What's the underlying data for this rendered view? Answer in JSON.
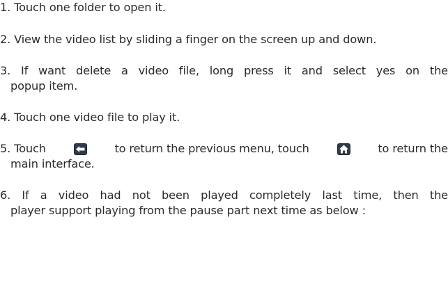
{
  "steps": [
    {
      "lines": [
        "1. Touch one folder to open it."
      ]
    },
    {
      "lines": [
        "2. View the video list by sliding a finger on the screen up and down."
      ]
    },
    {
      "lines": [
        "3. If want delete a video file, long press it and select yes on the",
        "popup item."
      ]
    },
    {
      "lines": [
        "4. Touch one video file to play it."
      ]
    },
    {
      "line1_a": "5. Touch",
      "line1_b": "to return the previous menu, touch",
      "line1_c": "to return the",
      "line2": "main interface.",
      "icons": [
        "back-arrow-icon",
        "home-icon"
      ]
    },
    {
      "lines": [
        "6. If a video had not been played completely last time, then the",
        "player support playing from the pause part next time as below :"
      ]
    }
  ],
  "colors": {
    "text": "#2b2b2b",
    "icon_bg": "#2f3a4a",
    "icon_fg": "#ffffff"
  }
}
